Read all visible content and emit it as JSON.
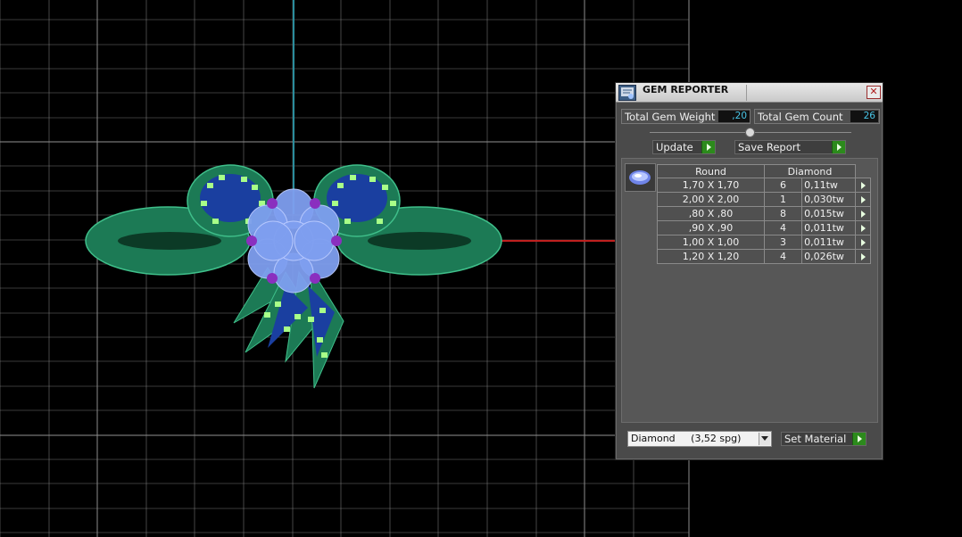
{
  "panel": {
    "title": "GEM REPORTER",
    "close_label": "✕",
    "total_weight_label": "Total Gem Weight",
    "total_weight_value": ",20",
    "total_count_label": "Total Gem Count",
    "total_count_value": "26",
    "update_label": "Update",
    "save_report_label": "Save Report",
    "table": {
      "headers": [
        "Round",
        "Diamond"
      ],
      "rows": [
        {
          "size": "1,70 X 1,70",
          "count": "6",
          "weight": "0,11tw"
        },
        {
          "size": "2,00 X 2,00",
          "count": "1",
          "weight": "0,030tw"
        },
        {
          "size": ",80 X ,80",
          "count": "8",
          "weight": "0,015tw"
        },
        {
          "size": ",90 X ,90",
          "count": "4",
          "weight": "0,011tw"
        },
        {
          "size": "1,00 X 1,00",
          "count": "3",
          "weight": "0,011tw"
        },
        {
          "size": "1,20 X 1,20",
          "count": "4",
          "weight": "0,026tw"
        }
      ]
    },
    "material_select": "Diamond     (3,52 spg)",
    "set_material_label": "Set Material"
  },
  "colors": {
    "viewport_bg": "#000000",
    "grid": "#8a8a8a",
    "axis_y": "#2b8d9c",
    "axis_x": "#c0201f",
    "model_body": "#1c7a55",
    "gem_fill": "#7f9ff0",
    "prong": "#8a2fbf",
    "accent_gems": "#a8ff88",
    "panel_bg": "#4a4a4a",
    "value_text": "#49c6e8",
    "go_button": "#2c8a1c"
  },
  "icons": [
    "gem-reporter-icon",
    "close-icon",
    "gem-round-icon",
    "arrow-right-icon",
    "chevron-down-icon"
  ]
}
